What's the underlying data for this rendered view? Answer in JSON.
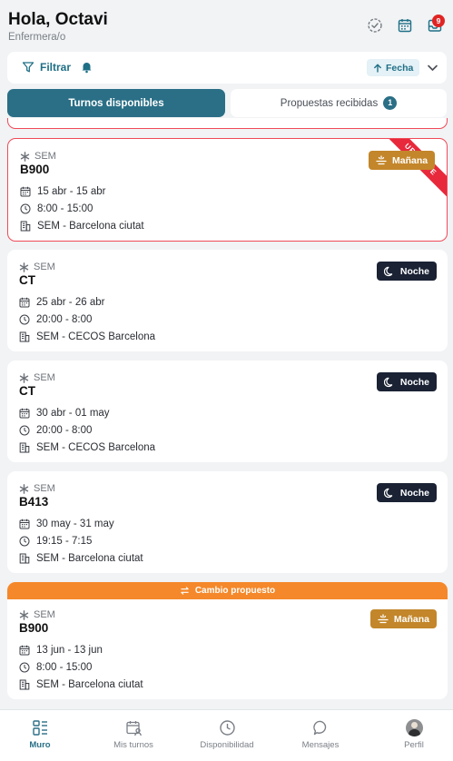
{
  "header": {
    "greeting": "Hola, Octavi",
    "role": "Enfermera/o",
    "icons": [
      "check-circle-icon",
      "calendar-icon",
      "inbox-icon"
    ],
    "inbox_badge": "9"
  },
  "filters": {
    "filter_label": "Filtrar",
    "sort_label": "Fecha"
  },
  "tabs": {
    "available": "Turnos disponibles",
    "received": "Propuestas recibidas",
    "received_count": "1"
  },
  "shifts": [
    {
      "org": "SEM",
      "code": "B900",
      "dates": "15 abr - 15 abr",
      "time": "8:00 - 15:00",
      "place": "SEM - Barcelona ciutat",
      "shift": "Mañana",
      "urgent": true,
      "ribbon": "URGENTE"
    },
    {
      "org": "SEM",
      "code": "CT",
      "dates": "25 abr - 26 abr",
      "time": "20:00 - 8:00",
      "place": "SEM - CECOS Barcelona",
      "shift": "Noche"
    },
    {
      "org": "SEM",
      "code": "CT",
      "dates": "30 abr - 01 may",
      "time": "20:00 - 8:00",
      "place": "SEM - CECOS Barcelona",
      "shift": "Noche"
    },
    {
      "org": "SEM",
      "code": "B413",
      "dates": "30 may - 31 may",
      "time": "19:15 - 7:15",
      "place": "SEM - Barcelona ciutat",
      "shift": "Noche"
    },
    {
      "org": "SEM",
      "code": "B900",
      "dates": "13 jun - 13 jun",
      "time": "8:00 - 15:00",
      "place": "SEM - Barcelona ciutat",
      "shift": "Mañana",
      "proposal": "Cambio propuesto"
    }
  ],
  "nav": [
    {
      "label": "Muro",
      "icon": "dashboard-icon",
      "active": true
    },
    {
      "label": "Mis turnos",
      "icon": "calendar-user-icon"
    },
    {
      "label": "Disponibilidad",
      "icon": "clock-icon"
    },
    {
      "label": "Mensajes",
      "icon": "chat-icon"
    },
    {
      "label": "Perfil",
      "icon": "avatar"
    }
  ],
  "colors": {
    "primary": "#2a6f86",
    "urgent": "#e8283b",
    "morning": "#c3862a",
    "night": "#1a2234",
    "proposal": "#f5882a"
  }
}
